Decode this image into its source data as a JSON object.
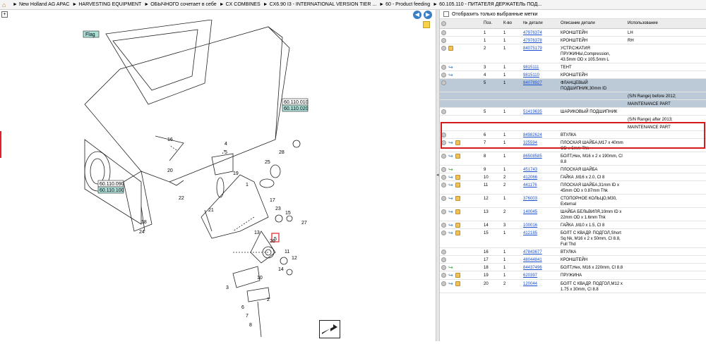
{
  "breadcrumb": [
    "New Holland AG APAC",
    "HARVESTING EQUIPMENT",
    "ОБЫЧНОГО сочетает в себе",
    "CX COMBINES",
    "CX6.90 I3 - INTERNATIONAL VERSION TIER ...",
    "60 - Product feeding",
    "60.105.110 - ПИТАТЕЛЯ ДЕРЖАТЕЛЬ ПОД..."
  ],
  "diagram": {
    "ref_top": "60.110.010",
    "ref_top_sel": "60.110.020",
    "ref_left": "60.110.090",
    "ref_left_sel": "60.110.100",
    "flag_label": "Flag",
    "callouts": [
      "1",
      "2",
      "3",
      "4",
      "5",
      "6",
      "7",
      "8",
      "10",
      "11",
      "12",
      "13",
      "14",
      "15",
      "16",
      "17",
      "18",
      "19",
      "20",
      "21",
      "22",
      "23",
      "24",
      "25",
      "26",
      "27",
      "28",
      "29"
    ]
  },
  "filter": {
    "label": "Отобразить только выбранные метки"
  },
  "table": {
    "headers": [
      "Поз.",
      "К-во",
      "№ детали",
      "Описание детали",
      "Использование"
    ],
    "rows": [
      {
        "pos": "1",
        "qty": "1",
        "part": "47976374",
        "desc": "КРОНШТЕЙН",
        "use": "LH",
        "icons": [
          "circle"
        ]
      },
      {
        "pos": "1",
        "qty": "1",
        "part": "47976378",
        "desc": "КРОНШТЕЙН",
        "use": "RH",
        "icons": [
          "circle"
        ]
      },
      {
        "pos": "2",
        "qty": "1",
        "part": "84075179",
        "desc": "УСТР.СЖАТИЯ ПРУЖИНЫ,Compression, 43.5mm OD x 105.5mm L",
        "use": "",
        "icons": [
          "circle",
          "box"
        ]
      },
      {
        "pos": "3",
        "qty": "1",
        "part": "9815111",
        "desc": "ТЕНТ",
        "use": "",
        "icons": [
          "circle",
          "arrow"
        ]
      },
      {
        "pos": "4",
        "qty": "1",
        "part": "9815110",
        "desc": "КРОНШТЕЙН",
        "use": "",
        "icons": [
          "circle",
          "arrow"
        ]
      },
      {
        "pos": "5",
        "qty": "1",
        "part": "84078927",
        "desc": "ФЛАНЦЕВЫЙ ПОДШИПНИК,30mm ID",
        "use": "",
        "sel": true,
        "icons": [
          "circle"
        ]
      },
      {
        "pos": "",
        "qty": "",
        "part": "",
        "desc": "",
        "use": "(S/N Range) before 2012;",
        "sel": true,
        "icons": []
      },
      {
        "pos": "",
        "qty": "",
        "part": "",
        "desc": "",
        "use": "MAINTENANCE PART",
        "sel": true,
        "icons": []
      },
      {
        "pos": "5",
        "qty": "1",
        "part": "51419635",
        "desc": "ШАРИКОВЫЙ ПОДШИПНИК",
        "use": "",
        "icons": [
          "circle"
        ]
      },
      {
        "pos": "",
        "qty": "",
        "part": "",
        "desc": "",
        "use": "(S/N Range) after 2013;",
        "icons": []
      },
      {
        "pos": "",
        "qty": "",
        "part": "",
        "desc": "",
        "use": "MAINTENANCE PART",
        "icons": []
      },
      {
        "pos": "6",
        "qty": "1",
        "part": "84982624",
        "desc": "ВТУЛКА",
        "use": "",
        "icons": [
          "circle"
        ]
      },
      {
        "pos": "7",
        "qty": "1",
        "part": "325594",
        "desc": "ПЛОСКАЯ ШАЙБА,M17 x 40mm OD x 5mm Thk",
        "use": "",
        "icons": [
          "circle",
          "arrow",
          "box"
        ]
      },
      {
        "pos": "8",
        "qty": "1",
        "part": "86508585",
        "desc": "БОЛТ,Hex, M16 x 2 x 190mm, Cl 8.8",
        "use": "",
        "icons": [
          "circle",
          "arrow",
          "box"
        ]
      },
      {
        "pos": "9",
        "qty": "1",
        "part": "451743",
        "desc": "ПЛОСКАЯ ШАЙБА",
        "use": "",
        "icons": [
          "circle",
          "green"
        ]
      },
      {
        "pos": "10",
        "qty": "2",
        "part": "412066",
        "desc": "ГАЙКА ,M16 x 2.0, Cl 8",
        "use": "",
        "icons": [
          "circle",
          "arrow",
          "box"
        ]
      },
      {
        "pos": "11",
        "qty": "2",
        "part": "441176",
        "desc": "ПЛОСКАЯ ШАЙБА,31mm ID x 45mm OD x 0.87mm Thk",
        "use": "",
        "icons": [
          "circle",
          "arrow",
          "box"
        ]
      },
      {
        "pos": "12",
        "qty": "1",
        "part": "376003",
        "desc": "СТОПОРНОЕ КОЛЬЦО,M30, External",
        "use": "",
        "icons": [
          "circle",
          "arrow",
          "box"
        ]
      },
      {
        "pos": "13",
        "qty": "2",
        "part": "140045",
        "desc": "ШАЙБА БЕЛЬВИЛЯ,10mm ID x 22mm OD x 1.6mm Thk",
        "use": "",
        "icons": [
          "circle",
          "arrow",
          "box"
        ]
      },
      {
        "pos": "14",
        "qty": "3",
        "part": "100016",
        "desc": "ГАЙКА ,M10 x 1.5, Cl 8",
        "use": "",
        "icons": [
          "circle",
          "arrow",
          "box"
        ]
      },
      {
        "pos": "15",
        "qty": "1",
        "part": "412185",
        "desc": "БОЛТ С КВАДР. ПОДГОЛ,Short Sq Nk, M16 x 2 x 50mm, Cl 8.8, Full Thd",
        "use": "",
        "icons": [
          "circle",
          "arrow",
          "box"
        ]
      },
      {
        "pos": "16",
        "qty": "1",
        "part": "47843677",
        "desc": "ВТУЛКА",
        "use": "",
        "icons": [
          "circle"
        ]
      },
      {
        "pos": "17",
        "qty": "1",
        "part": "48044841",
        "desc": "КРОНШТЕЙН",
        "use": "",
        "icons": [
          "circle"
        ]
      },
      {
        "pos": "18",
        "qty": "1",
        "part": "84437496",
        "desc": "БОЛТ,Hex, M16 x 220mm, Cl 8.8",
        "use": "",
        "icons": [
          "circle",
          "green"
        ]
      },
      {
        "pos": "19",
        "qty": "1",
        "part": "620397",
        "desc": "ПРУЖИНА",
        "use": "",
        "icons": [
          "circle",
          "arrow",
          "box"
        ]
      },
      {
        "pos": "20",
        "qty": "2",
        "part": "120044",
        "desc": "БОЛТ С КВАДР. ПОДГОЛ,M12 x 1.75 x 30mm, Cl 8.8",
        "use": "",
        "icons": [
          "circle",
          "arrow",
          "box"
        ]
      }
    ]
  }
}
